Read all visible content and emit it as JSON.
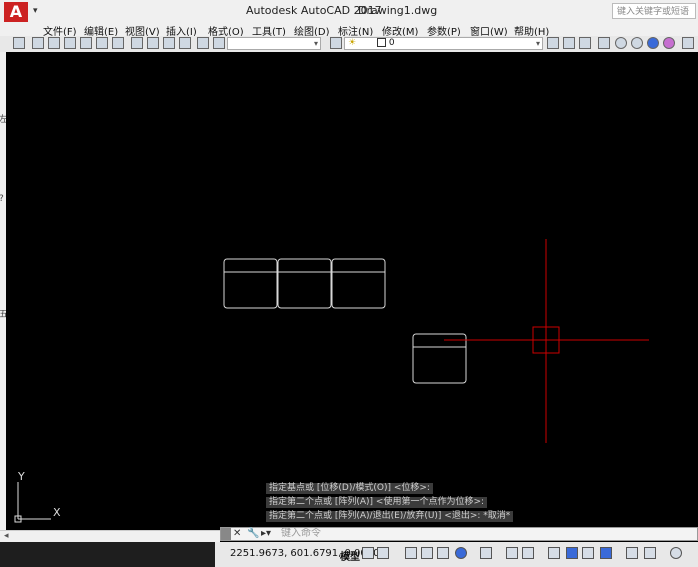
{
  "titlebar": {
    "logo": "A",
    "app_title": "Autodesk AutoCAD 2017",
    "document_title": "Drawing1.dwg",
    "search_placeholder": "键入关键字或短语"
  },
  "menu": [
    {
      "label": "文件(F)"
    },
    {
      "label": "编辑(E)"
    },
    {
      "label": "视图(V)"
    },
    {
      "label": "插入(I)"
    },
    {
      "label": "格式(O)"
    },
    {
      "label": "工具(T)"
    },
    {
      "label": "绘图(D)"
    },
    {
      "label": "标注(N)"
    },
    {
      "label": "修改(M)"
    },
    {
      "label": "参数(P)"
    },
    {
      "label": "窗口(W)"
    },
    {
      "label": "帮助(H)"
    }
  ],
  "toolbar": {
    "layer_value": "0"
  },
  "left_strip": {
    "labels": [
      "左",
      "?",
      "五"
    ]
  },
  "ucs": {
    "x_label": "X",
    "y_label": "Y"
  },
  "command": {
    "history": [
      "指定基点或 [位移(D)/模式(O)] <位移>:",
      "指定第二个点或 [阵列(A)] <使用第一个点作为位移>:",
      "指定第二个点或 [阵列(A)/退出(E)/放弃(U)] <退出>: *取消*"
    ],
    "input_placeholder": "键入命令"
  },
  "status": {
    "coordinates": "2251.9673, 601.6791, 0.0000",
    "model_label": "模型"
  },
  "colors": {
    "canvas_bg": "#000000",
    "crosshair": "#cc0000",
    "geometry": "#d8d8d8"
  }
}
